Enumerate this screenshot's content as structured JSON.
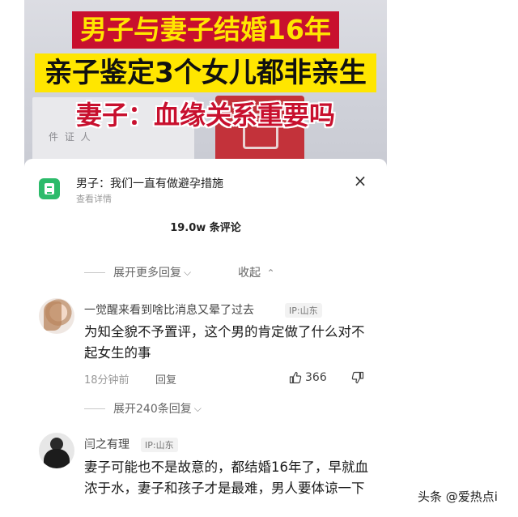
{
  "banner": {
    "line1": "男子与妻子结婚16年",
    "line2": "亲子鉴定3个女儿都非亲生",
    "line3": "妻子：血缘关系重要吗",
    "doc_text": "件 证 人"
  },
  "source": {
    "title": "男子：我们一直有做避孕措施",
    "subtitle": "查看详情",
    "icon": "document-icon",
    "close_icon": "×"
  },
  "comments_header": {
    "count": "19.0w 条评论"
  },
  "reply_controls": {
    "expand_more": "展开更多回复",
    "collapse": "收起",
    "chevron_down": "⌵",
    "chevron_up": "⌃"
  },
  "comments": [
    {
      "user": "一觉醒来看到啥比消息又晕了过去",
      "ip": "IP:山东",
      "text": "为知全貌不予置评，这个男的肯定做了什么对不起女生的事",
      "time": "18分钟前",
      "reply": "回复",
      "likes": "366",
      "expand_replies": "展开240条回复"
    },
    {
      "user": "闫之有理",
      "ip": "IP:山东",
      "text": "妻子可能也不是故意的，都结婚16年了，早就血浓于水，妻子和孩子才是最难，男人要体谅一下"
    }
  ],
  "watermark": "头条 @爱热点i",
  "colors": {
    "accent_green": "#2dbb6b",
    "headline_red": "#c8102e",
    "headline_yellow": "#ffe600"
  }
}
